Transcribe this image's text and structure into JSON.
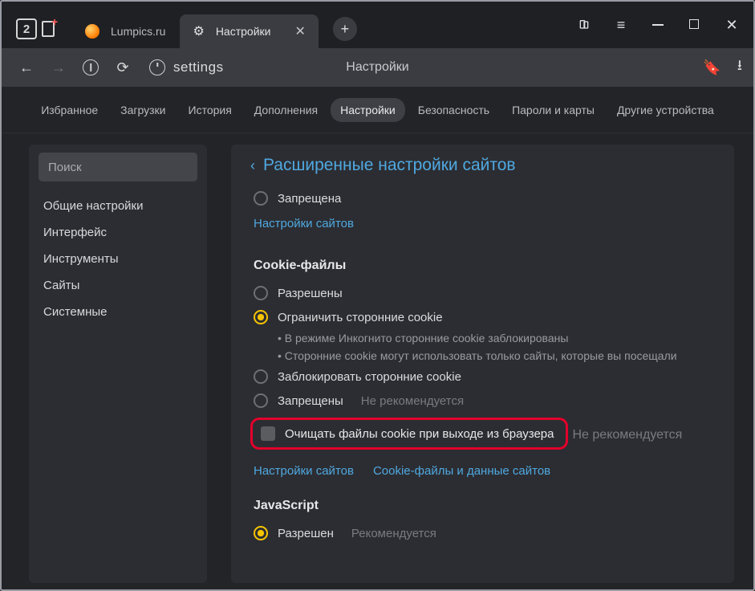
{
  "titlebar": {
    "tab_counter": "2",
    "tab_lumpics": "Lumpics.ru",
    "tab_settings": "Настройки",
    "newtab_tooltip": "+"
  },
  "addr": {
    "path": "settings",
    "title": "Настройки"
  },
  "topnav": {
    "favorites": "Избранное",
    "downloads": "Загрузки",
    "history": "История",
    "addons": "Дополнения",
    "settings": "Настройки",
    "security": "Безопасность",
    "passwords": "Пароли и карты",
    "other_devices": "Другие устройства"
  },
  "sidebar": {
    "search_placeholder": "Поиск",
    "items": {
      "general": "Общие настройки",
      "interface": "Интерфейс",
      "tools": "Инструменты",
      "sites": "Сайты",
      "system": "Системные"
    }
  },
  "main": {
    "header": "Расширенные настройки сайтов",
    "first_block": {
      "radio_denied": "Запрещена",
      "link_site_settings": "Настройки сайтов"
    },
    "cookie": {
      "section": "Cookie-файлы",
      "opt_allowed": "Разрешены",
      "opt_limit": "Ограничить сторонние cookie",
      "bullet1": "В режиме Инкогнито сторонние cookie заблокированы",
      "bullet2": "Сторонние cookie могут использовать только сайты, которые вы посещали",
      "opt_block_third": "Заблокировать сторонние cookie",
      "opt_denied": "Запрещены",
      "not_recommended": "Не рекомендуется",
      "checkbox_clear": "Очищать файлы cookie при выходе из браузера",
      "link_sites": "Настройки сайтов",
      "link_cookie_data": "Cookie-файлы и данные сайтов"
    },
    "js": {
      "section": "JavaScript",
      "opt_allowed": "Разрешен",
      "recommended": "Рекомендуется"
    }
  }
}
